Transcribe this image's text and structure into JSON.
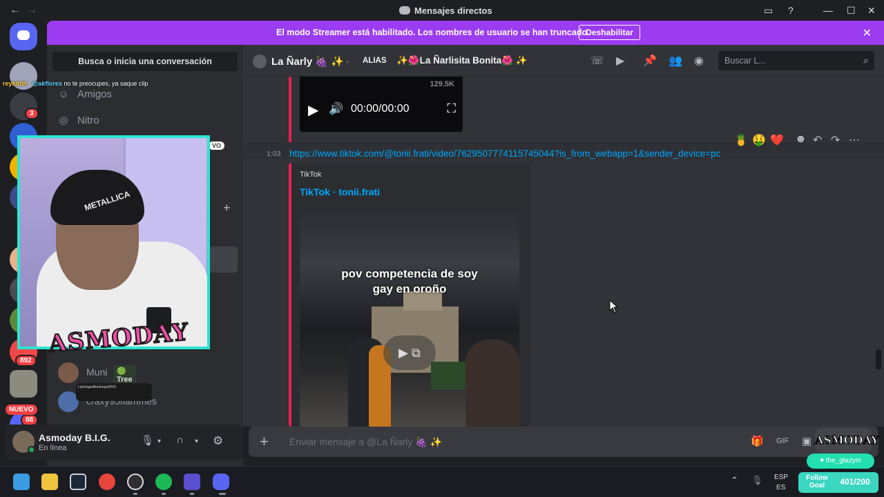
{
  "window": {
    "title": "Mensajes directos",
    "back": "←",
    "forward": "→"
  },
  "banner": {
    "text": "El modo Streamer está habilitado. Los nombres de usuario se han truncado.",
    "button": "Deshabilitar",
    "close": "✕"
  },
  "rail": {
    "badges": [
      "3",
      "892"
    ],
    "new_label": "NUEVO",
    "bottom_badge": "88"
  },
  "dm_sidebar": {
    "search": "Busca o inicia una conversación",
    "nav": [
      {
        "label": "Amigos",
        "icon": "friends-icon"
      },
      {
        "label": "Nitro",
        "icon": "nitro-icon"
      }
    ],
    "add_dm": "+",
    "dms": [
      {
        "name": "Muni",
        "tag": "Tree",
        "tag_icon": "🟢"
      },
      {
        "name": "craxy95flammes"
      }
    ]
  },
  "user": {
    "name": "Asmoday B.I.G.",
    "status": "En línea"
  },
  "chat_header": {
    "name": "La Ñarly 🍇 ✨",
    "alias_label": "ALIAS",
    "alias_value": "✨🌺La Ñarlisita Bonita🌺 ✨",
    "search_placeholder": "Buscar L..."
  },
  "messages": {
    "video": {
      "views": "129.5K",
      "time": "00:00/00:00"
    },
    "timestamp": "1:03",
    "link": "https://www.tiktok.com/@tonii.frati/video/7629507774115745044?is_from_webapp=1&sender_device=pc",
    "reactions": [
      "🍍",
      "🤑",
      "❤️"
    ],
    "embed": {
      "provider": "TikTok",
      "title": "TikTok · tonii.frati",
      "caption_line1": "pov competencia de soy",
      "caption_line2": "gay en oroño"
    }
  },
  "composer": {
    "placeholder": "Enviar mensaje a @La Ñarly 🍇 ✨",
    "plus": "+"
  },
  "taskbar": {
    "lang_top": "ESP",
    "lang_bottom": "ES"
  },
  "stream_overlay": {
    "chat_user": "reykitdh",
    "chat_mention": "@akflores",
    "chat_text": "no te preocupes, ya saque clip",
    "vo_tag": "VO",
    "hat_text": "METALLICA",
    "logo_text": "ASMODAY",
    "alert_title": "LasVegasBurlesqueNVO",
    "corner_logo": "ASMODAY B.I.G.",
    "handle": "the_glazym",
    "follow_goal_label": "Follow Goal",
    "follow_goal_count": "401/200"
  },
  "colors": {
    "banner": "#9b3cf0",
    "link": "#00a8fc",
    "embed_accent": "#ee1d52",
    "webcam_border": "#2be5d2",
    "online": "#23a55a"
  }
}
